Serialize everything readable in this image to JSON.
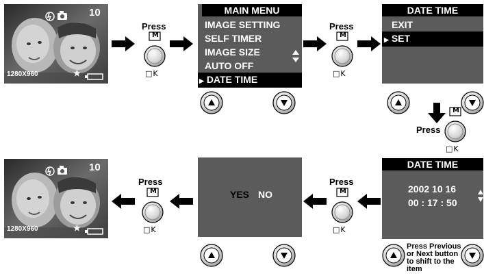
{
  "photo": {
    "counter": "10",
    "resolution": "1280X960",
    "star": "★"
  },
  "press_label": "Press",
  "m_label": "M",
  "ok_label": "□K",
  "main_menu": {
    "title": "MAIN MENU",
    "items": [
      "IMAGE SETTING",
      "SELF TIMER",
      "IMAGE SIZE",
      "AUTO OFF",
      "DATE TIME"
    ],
    "selected_index": 4
  },
  "date_time_menu": {
    "title": "DATE TIME",
    "items": [
      "EXIT",
      "SET"
    ],
    "selected_index": 1
  },
  "date_time_set": {
    "title": "DATE TIME",
    "date": "2002 10 16",
    "time": "00 : 17 : 50"
  },
  "confirm": {
    "yes": "YES",
    "no": "NO"
  },
  "note": "Press Previous or Next button to shift to the item"
}
